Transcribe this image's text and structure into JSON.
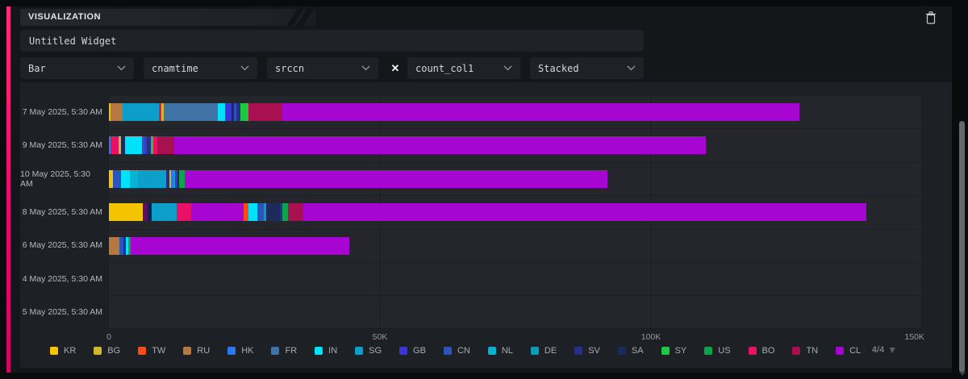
{
  "accent_color": "#e4086b",
  "header": {
    "title": "VISUALIZATION"
  },
  "widget": {
    "name_value": "Untitled Widget"
  },
  "controls": {
    "chart_type": "Bar",
    "x_field": "cnamtime",
    "split_field": "srccn",
    "remove_label": "✕",
    "y_field": "count_col1",
    "stack_mode": "Stacked"
  },
  "pagination": {
    "label": "4/4"
  },
  "chart_data": {
    "type": "bar",
    "orientation": "horizontal",
    "stacked": true,
    "title": "",
    "xlabel": "",
    "ylabel": "",
    "xlim": [
      0,
      150000
    ],
    "x_ticks": [
      {
        "label": "0",
        "value": 0
      },
      {
        "label": "50K",
        "value": 50000
      },
      {
        "label": "100K",
        "value": 100000
      },
      {
        "label": "150K",
        "value": 150000
      }
    ],
    "grid": "on",
    "legend_position": "bottom",
    "legend": [
      "KR",
      "BG",
      "TW",
      "RU",
      "HK",
      "FR",
      "IN",
      "SG",
      "GB",
      "CN",
      "NL",
      "DE",
      "SV",
      "SA",
      "SY",
      "US",
      "BO",
      "TN",
      "CL"
    ],
    "series_colors": {
      "KR": "#f5c400",
      "BG": "#cdb929",
      "TW": "#fb4a16",
      "RU": "#b5793f",
      "HK": "#2b77f0",
      "FR": "#3f73a5",
      "IN": "#00e2fa",
      "SG": "#0c9fc9",
      "GB": "#3b35d4",
      "CN": "#2d54bb",
      "NL": "#08b2d3",
      "DE": "#0b9db5",
      "SV": "#272f8c",
      "SA": "#1c2a5e",
      "SY": "#1fc83e",
      "US": "#0ea44b",
      "BO": "#e81166",
      "TN": "#a8104f",
      "CL": "#a705d2"
    },
    "rows": [
      {
        "label": "7 May 2025, 5:30 AM",
        "total": 127450,
        "segments": [
          [
            "KR",
            250
          ],
          [
            "RU",
            2250
          ],
          [
            "SG",
            6700
          ],
          [
            "BO",
            450
          ],
          [
            "BG",
            450
          ],
          [
            "FR",
            10000
          ],
          [
            "IN",
            1300
          ],
          [
            "GB",
            1200
          ],
          [
            "SA",
            500
          ],
          [
            "CN",
            350
          ],
          [
            "SV",
            800
          ],
          [
            "SY",
            1500
          ],
          [
            "TN",
            6200
          ],
          [
            "CL",
            95500
          ]
        ]
      },
      {
        "label": "9 May 2025, 5:30 AM",
        "total": 110100,
        "segments": [
          [
            "HK",
            300
          ],
          [
            "BO",
            1500
          ],
          [
            "BG",
            500
          ],
          [
            "SA",
            700
          ],
          [
            "IN",
            3100
          ],
          [
            "CN",
            500
          ],
          [
            "GB",
            400
          ],
          [
            "SV",
            750
          ],
          [
            "SY",
            500
          ],
          [
            "BO",
            750
          ],
          [
            "TN",
            3100
          ],
          [
            "CL",
            98000
          ]
        ]
      },
      {
        "label": "10 May 2025, 5:30 AM",
        "total": 92000,
        "segments": [
          [
            "KR",
            700
          ],
          [
            "CN",
            1600
          ],
          [
            "IN",
            1600
          ],
          [
            "NL",
            1400
          ],
          [
            "SG",
            5300
          ],
          [
            "SV",
            500
          ],
          [
            "BG",
            350
          ],
          [
            "HK",
            500
          ],
          [
            "DE",
            300
          ],
          [
            "GB",
            400
          ],
          [
            "SA",
            350
          ],
          [
            "US",
            1000
          ],
          [
            "CL",
            78000
          ]
        ]
      },
      {
        "label": "8 May 2025, 5:30 AM",
        "total": 139800,
        "segments": [
          [
            "KR",
            6300
          ],
          [
            "GB",
            850,
            "#571066"
          ],
          [
            "SV",
            800,
            "#15204a"
          ],
          [
            "SG",
            4500
          ],
          [
            "BO",
            2700
          ],
          [
            "CL",
            9700
          ],
          [
            "TW",
            900
          ],
          [
            "IN",
            1600
          ],
          [
            "CN",
            1300
          ],
          [
            "DE",
            350
          ],
          [
            "SA",
            2600
          ],
          [
            "SV",
            400
          ],
          [
            "US",
            1100
          ],
          [
            "TN",
            2700
          ],
          [
            "CL",
            104000
          ]
        ]
      },
      {
        "label": "6 May 2025, 5:30 AM",
        "total": 44300,
        "segments": [
          [
            "RU",
            2000
          ],
          [
            "CN",
            750
          ],
          [
            "SV",
            350
          ],
          [
            "IN",
            400
          ],
          [
            "US",
            500
          ],
          [
            "CL",
            40300
          ]
        ]
      },
      {
        "label": "4 May 2025, 5:30 AM",
        "total": 0,
        "segments": []
      },
      {
        "label": "5 May 2025, 5:30 AM",
        "total": 0,
        "segments": []
      }
    ]
  }
}
